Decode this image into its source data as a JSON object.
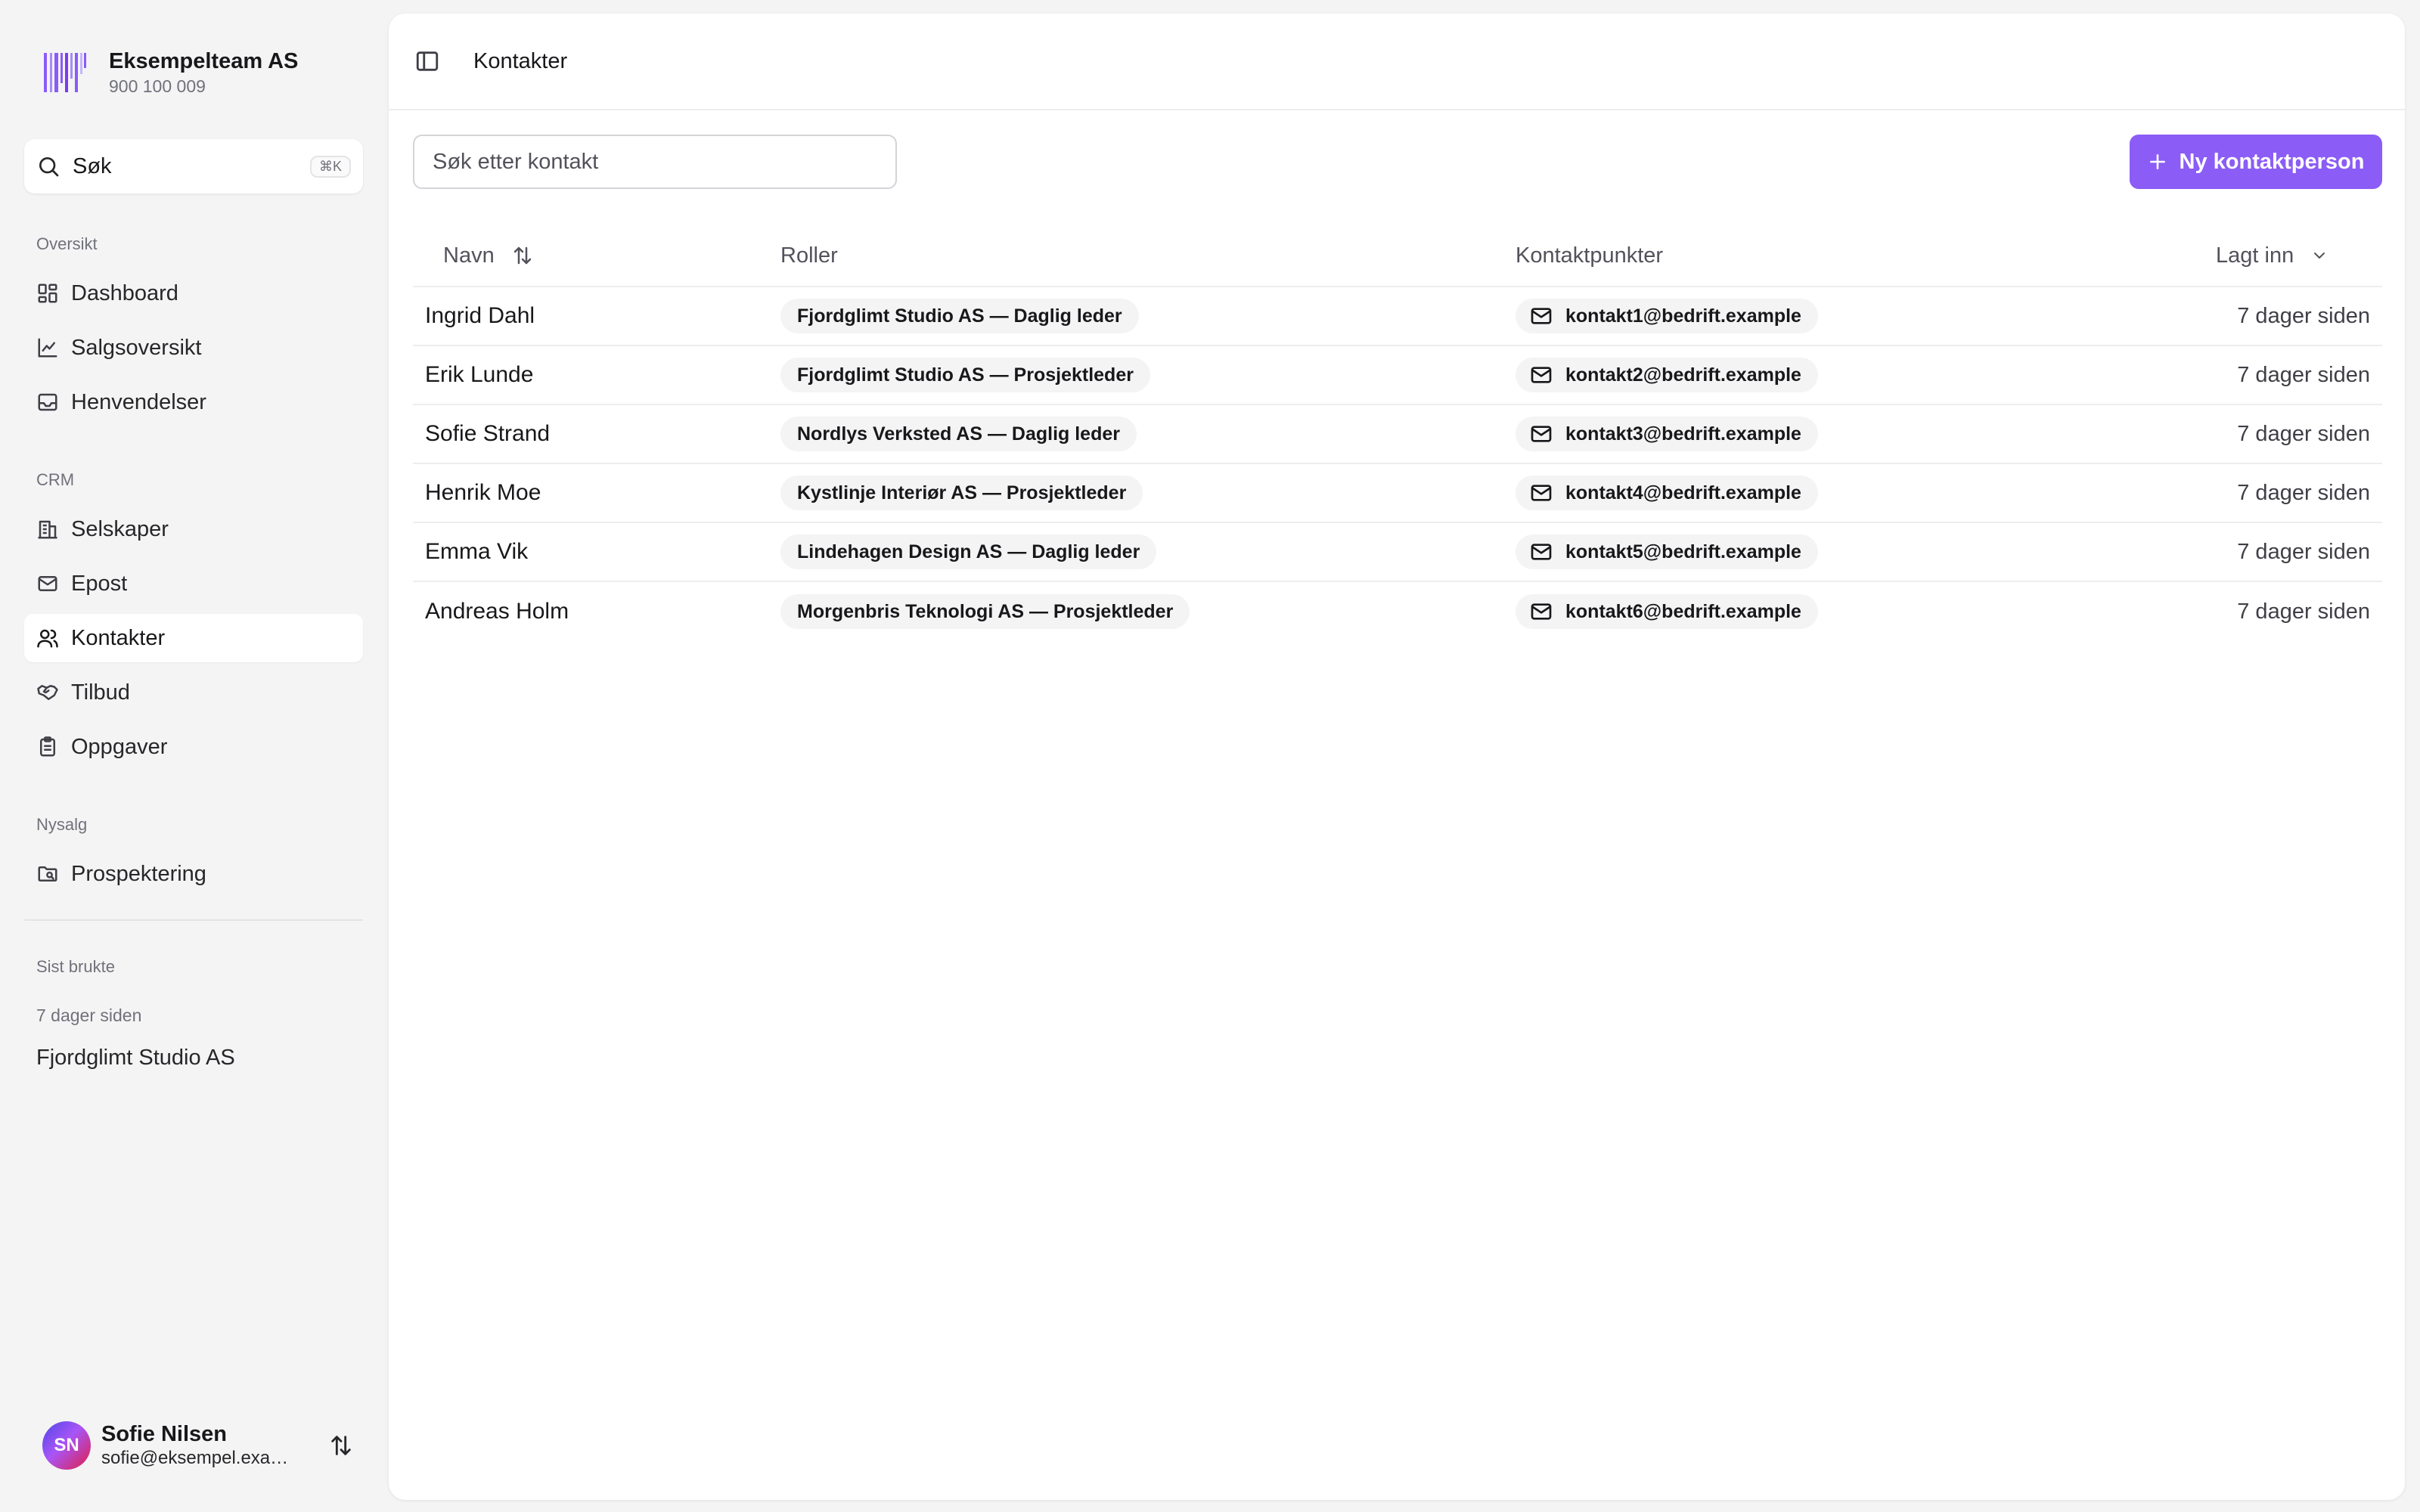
{
  "sidebar": {
    "team": {
      "name": "Eksempelteam AS",
      "org_number": "900 100 009",
      "logo_icon": "barcode-logo-icon",
      "accent": "#8b5cf6"
    },
    "search": {
      "label": "Søk",
      "shortcut": "⌘K"
    },
    "sections": {
      "overview": "Oversikt",
      "crm": "CRM",
      "nysalg": "Nysalg",
      "recent": "Sist brukte"
    },
    "items": [
      {
        "label": "Dashboard",
        "icon": "dashboard-icon"
      },
      {
        "label": "Salgsoversikt",
        "icon": "chart-line-icon"
      },
      {
        "label": "Henvendelser",
        "icon": "inbox-icon"
      },
      {
        "label": "Selskaper",
        "icon": "building-icon"
      },
      {
        "label": "Epost",
        "icon": "mail-icon"
      },
      {
        "label": "Kontakter",
        "icon": "users-icon",
        "active": true
      },
      {
        "label": "Tilbud",
        "icon": "handshake-icon"
      },
      {
        "label": "Oppgaver",
        "icon": "clipboard-icon"
      },
      {
        "label": "Prospektering",
        "icon": "folder-search-icon"
      }
    ],
    "recent": {
      "time": "7 dager siden",
      "item": "Fjordglimt Studio AS"
    },
    "user": {
      "initials": "SN",
      "name": "Sofie Nilsen",
      "email": "sofie@eksempel.example"
    }
  },
  "header": {
    "title": "Kontakter"
  },
  "toolbar": {
    "search_placeholder": "Søk etter kontakt",
    "new_button": "Ny kontaktperson",
    "button_color": "#8b5cf6"
  },
  "table": {
    "columns": {
      "name": "Navn",
      "roles": "Roller",
      "contacts": "Kontaktpunkter",
      "added": "Lagt inn"
    },
    "rows": [
      {
        "name": "Ingrid Dahl",
        "role": "Fjordglimt Studio AS — Daglig leder",
        "email": "kontakt1@bedrift.example",
        "added": "7 dager siden"
      },
      {
        "name": "Erik Lunde",
        "role": "Fjordglimt Studio AS — Prosjektleder",
        "email": "kontakt2@bedrift.example",
        "added": "7 dager siden"
      },
      {
        "name": "Sofie Strand",
        "role": "Nordlys Verksted AS — Daglig leder",
        "email": "kontakt3@bedrift.example",
        "added": "7 dager siden"
      },
      {
        "name": "Henrik Moe",
        "role": "Kystlinje Interiør AS — Prosjektleder",
        "email": "kontakt4@bedrift.example",
        "added": "7 dager siden"
      },
      {
        "name": "Emma Vik",
        "role": "Lindehagen Design AS — Daglig leder",
        "email": "kontakt5@bedrift.example",
        "added": "7 dager siden"
      },
      {
        "name": "Andreas Holm",
        "role": "Morgenbris Teknologi AS — Prosjektleder",
        "email": "kontakt6@bedrift.example",
        "added": "7 dager siden"
      }
    ]
  }
}
